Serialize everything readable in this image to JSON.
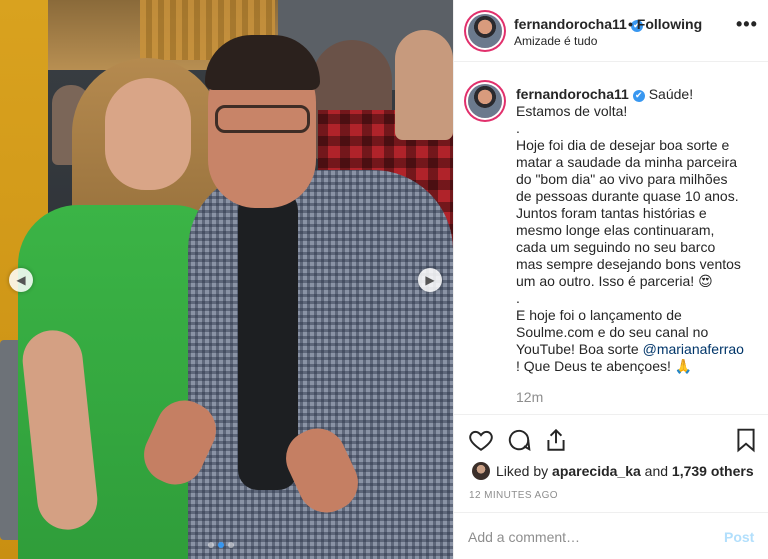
{
  "post": {
    "username": "fernandorocha11",
    "verified_icon": "✔",
    "follow_separator": "•",
    "follow_status": "Following",
    "subtitle": "Amizade é tudo",
    "more_icon": "•••",
    "photo": {
      "current_slide": 2,
      "total_slides": 3,
      "prev_arrow": "◀",
      "next_arrow": "▶"
    }
  },
  "caption": {
    "username": "fernandorocha11",
    "first_line": "Saúde!",
    "lines": [
      "Estamos de volta!",
      ".",
      "Hoje foi dia de desejar boa sorte e",
      "matar a saudade da minha parceira",
      "do \"bom dia\" ao vivo para milhões",
      "de pessoas durante quase 10 anos.",
      "Juntos foram tantas histórias e",
      "mesmo longe elas continuaram,",
      "cada um seguindo no seu barco",
      "mas sempre desejando bons ventos",
      "um ao outro. Isso é parceria! 😍",
      ".",
      "E hoje foi o lançamento de",
      "Soulme.com e do seu canal no",
      "YouTube! Boa sorte"
    ],
    "mention": "@marianaferrao",
    "last_line": "! Que Deus te abençoes! 🙏",
    "relative_time": "12m"
  },
  "actions": {
    "like_icon": "heart-icon",
    "comment_icon": "comment-icon",
    "share_icon": "share-icon",
    "save_icon": "bookmark-icon",
    "liked_by_prefix": "Liked by",
    "liked_by_user": "aparecida_ka",
    "liked_by_and": "and",
    "liked_by_others": "1,739 others",
    "timestamp": "12 MINUTES AGO"
  },
  "comment": {
    "placeholder": "Add a comment…",
    "post_label": "Post"
  },
  "colors": {
    "accent": "#3897f0",
    "post_disabled": "#b2dffc",
    "mention": "#003569"
  }
}
